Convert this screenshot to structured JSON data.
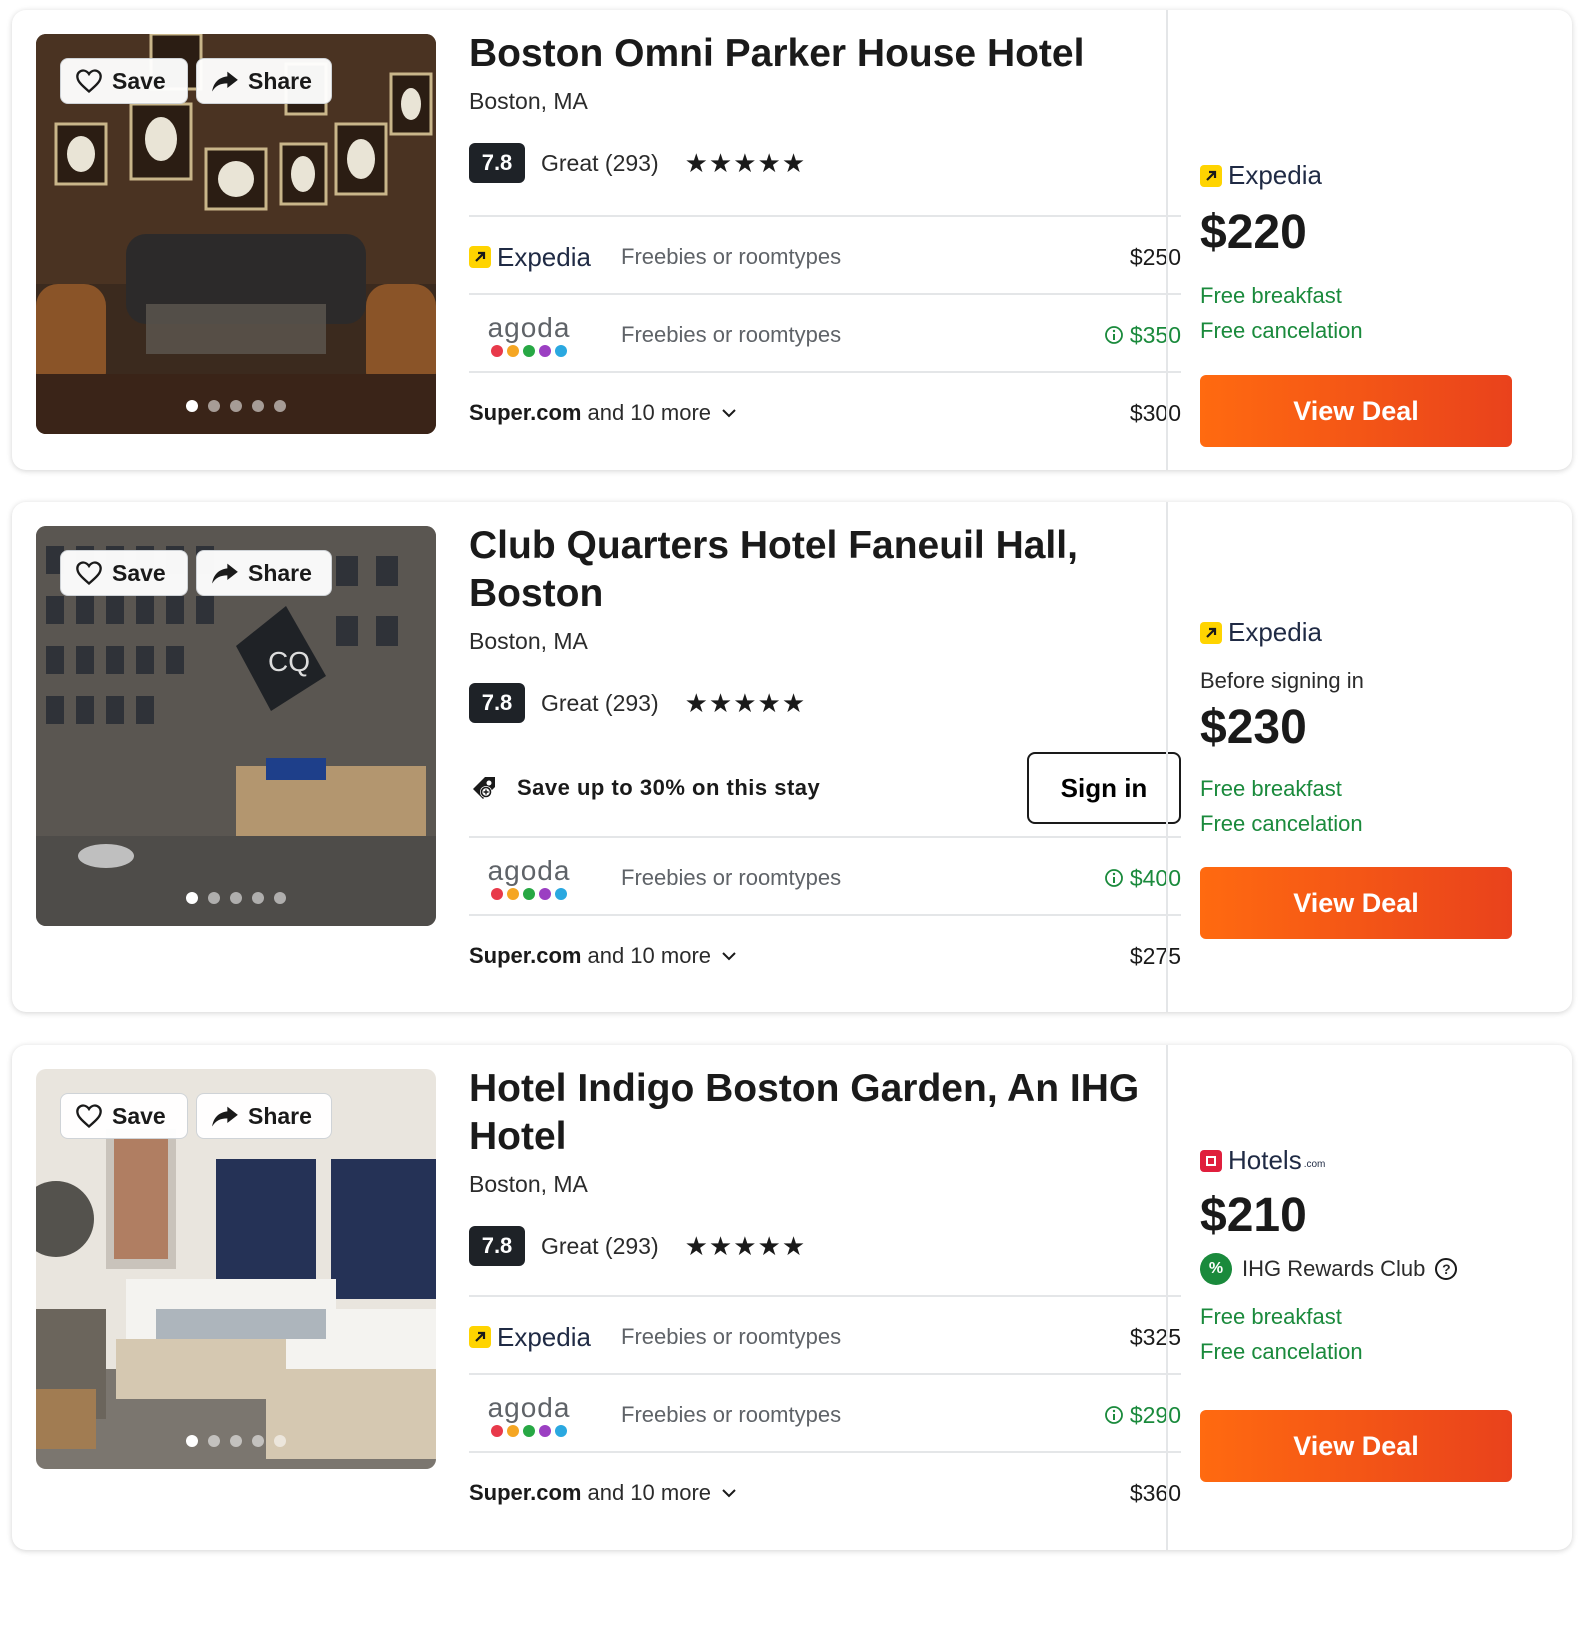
{
  "common": {
    "save_label": "Save",
    "share_label": "Share",
    "view_deal_label": "View Deal",
    "free_breakfast": "Free breakfast",
    "free_cancelation": "Free cancelation",
    "freebies_label": "Freebies or roomtypes",
    "and_more": "and 10 more",
    "provider_more": "Super.com",
    "expedia_name": "Expedia",
    "agoda_name": "agoda",
    "hotels_name": "Hotels",
    "hotels_suffix": ".com"
  },
  "colors": {
    "deal_button_start": "#ff6a10",
    "deal_button_end": "#e9421c",
    "perk_green": "#1a8a3c",
    "score_bg": "#1e2227",
    "expedia_yellow": "#ffd400",
    "hotels_red": "#e01f3d",
    "agoda_dots": [
      "#e8394a",
      "#f5a623",
      "#27a844",
      "#9b3fc2",
      "#2aa8e0"
    ]
  },
  "hotels": [
    {
      "name": "Boston Omni Parker House Hotel",
      "location": "Boston, MA",
      "score": "7.8",
      "rating_text": "Great (293)",
      "stars": "★★★★★",
      "photo_page": "1 of 5",
      "offers": [
        {
          "provider": "expedia",
          "price": "$250",
          "highlight": false
        },
        {
          "provider": "agoda",
          "price": "$350",
          "highlight": true
        }
      ],
      "more_price": "$300",
      "side": {
        "provider": "Expedia",
        "price": "$220"
      }
    },
    {
      "name": "Club Quarters Hotel Faneuil Hall, Boston",
      "location": "Boston, MA",
      "score": "7.8",
      "rating_text": "Great (293)",
      "stars": "★★★★★",
      "photo_page": "1 of 5",
      "promo": {
        "text": "Save up to 30% on this stay",
        "button": "Sign in"
      },
      "offers": [
        {
          "provider": "agoda",
          "price": "$400",
          "highlight": true
        }
      ],
      "more_price": "$275",
      "side": {
        "provider": "Expedia",
        "before": "Before signing in",
        "price": "$230"
      }
    },
    {
      "name": "Hotel Indigo Boston Garden, An IHG Hotel",
      "location": "Boston, MA",
      "score": "7.8",
      "rating_text": "Great (293)",
      "stars": "★★★★★",
      "photo_page": "1 of 5",
      "offers": [
        {
          "provider": "expedia",
          "price": "$325",
          "highlight": false
        },
        {
          "provider": "agoda",
          "price": "$290",
          "highlight": true
        }
      ],
      "more_price": "$360",
      "side": {
        "provider": "Hotels",
        "price": "$210",
        "reward": "IHG Rewards Club",
        "reward_badge": "%"
      }
    }
  ]
}
